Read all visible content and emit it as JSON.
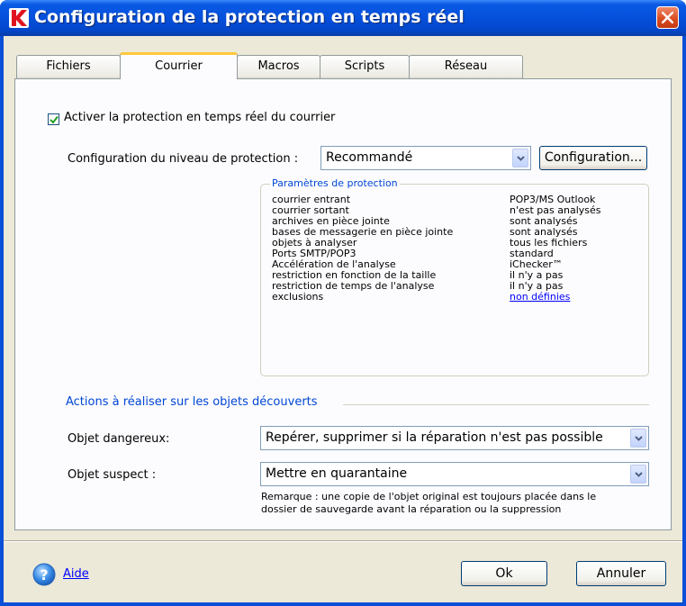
{
  "window": {
    "title": "Configuration de la protection en temps réel"
  },
  "tabs": [
    {
      "label": "Fichiers"
    },
    {
      "label": "Courrier",
      "active": true
    },
    {
      "label": "Macros"
    },
    {
      "label": "Scripts"
    },
    {
      "label": "Réseau"
    }
  ],
  "mail": {
    "enable_label": "Activer la protection en temps réel du courrier",
    "enable_checked": true,
    "level_label": "Configuration du niveau de protection :",
    "level_value": "Recommandé",
    "config_button": "Configuration...",
    "params_title": "Paramètres de protection",
    "params": [
      {
        "name": "courrier entrant",
        "value": "POP3/MS Outlook"
      },
      {
        "name": "courrier sortant",
        "value": "n'est pas analysés"
      },
      {
        "name": "archives en pièce jointe",
        "value": "sont analysés"
      },
      {
        "name": "bases de messagerie en pièce jointe",
        "value": "sont analysés"
      },
      {
        "name": "objets à analyser",
        "value": "tous les fichiers"
      },
      {
        "name": "Ports SMTP/POP3",
        "value": "standard"
      },
      {
        "name": "Accélération de l'analyse",
        "value": "iChecker™"
      },
      {
        "name": "restriction en fonction de la taille",
        "value": "il n'y a pas"
      },
      {
        "name": "restriction de temps de l'analyse",
        "value": "il n'y a pas"
      },
      {
        "name": "exclusions",
        "value": "non définies"
      }
    ],
    "actions_title": "Actions à réaliser sur les objets découverts",
    "dangerous_label": "Objet dangereux:",
    "dangerous_value": "Repérer, supprimer si la réparation n'est pas possible",
    "suspect_label": "Objet suspect :",
    "suspect_value": "Mettre en quarantaine",
    "note_line1": "Remarque : une copie de l'objet original est toujours placée dans le",
    "note_line2": "dossier de sauvegarde avant la réparation ou la suppression"
  },
  "footer": {
    "help_label": "Aide",
    "ok_label": "Ok",
    "cancel_label": "Annuler"
  },
  "colors": {
    "titlebar": "#0550dc",
    "close_button": "#d84a1e",
    "dialog_background": "#ece9d8",
    "group_title": "#0046d5",
    "link": "#0000ff",
    "active_tab_highlight": "#ffc83c"
  },
  "icons": {
    "app": "kaspersky-k-icon",
    "close": "close-icon",
    "checkbox": "checkmark-icon",
    "dropdown": "chevron-down-icon",
    "help": "question-mark-icon"
  }
}
